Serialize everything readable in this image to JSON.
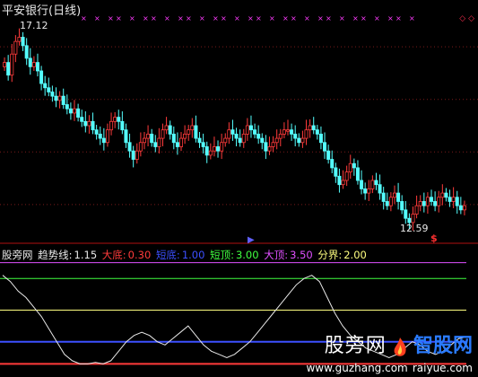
{
  "chart": {
    "title": "平安银行(日线)",
    "high_label": "17.12",
    "low_label": "12.59",
    "colors": {
      "up": "#ff3b3b",
      "down": "#54ffff",
      "bg": "#000000"
    }
  },
  "indicator": {
    "name": "股旁网",
    "trend": {
      "label": "趋势线:",
      "value": "1.15",
      "color": "#e8e8e8"
    },
    "bottom": {
      "label": "大底:",
      "value": "0.30",
      "color": "#ff3b3b"
    },
    "short_bottom": {
      "label": "短底:",
      "value": "1.00",
      "color": "#3c50ff"
    },
    "short_top": {
      "label": "短顶:",
      "value": "3.00",
      "color": "#40ff40"
    },
    "top": {
      "label": "大顶:",
      "value": "3.50",
      "color": "#e050ff"
    },
    "divider": {
      "label": "分界:",
      "value": "2.00",
      "color": "#ffff80"
    }
  },
  "watermark": {
    "cn": "股旁网",
    "brand": "智股网",
    "url": "www.guzhang.com",
    "url2": "raiyue.com"
  },
  "chart_data": [
    {
      "type": "candlestick",
      "title": "平安银行(日线)",
      "annotations": [
        "17.12",
        "12.59"
      ],
      "ylim": [
        12.3,
        17.5
      ],
      "close": [
        16.4,
        16.1,
        16.6,
        16.9,
        17.0,
        16.8,
        16.5,
        16.3,
        16.4,
        16.2,
        15.9,
        15.8,
        15.7,
        15.6,
        15.5,
        15.6,
        15.4,
        15.3,
        15.2,
        15.3,
        15.1,
        15.0,
        14.9,
        15.0,
        14.8,
        14.7,
        14.6,
        14.5,
        14.8,
        15.0,
        15.1,
        15.0,
        14.8,
        14.5,
        14.3,
        14.1,
        14.3,
        14.5,
        14.6,
        14.7,
        14.5,
        14.4,
        14.6,
        14.8,
        14.9,
        14.7,
        14.5,
        14.4,
        14.6,
        14.7,
        14.8,
        14.9,
        14.6,
        14.5,
        14.4,
        14.2,
        14.3,
        14.4,
        14.3,
        14.5,
        14.6,
        14.8,
        14.7,
        14.6,
        14.5,
        14.7,
        14.9,
        14.8,
        14.7,
        14.6,
        14.5,
        14.3,
        14.4,
        14.5,
        14.6,
        14.7,
        14.8,
        14.8,
        14.7,
        14.6,
        14.5,
        14.6,
        14.8,
        14.9,
        14.8,
        14.7,
        14.5,
        14.3,
        14.1,
        13.9,
        13.7,
        13.5,
        13.6,
        13.8,
        14.0,
        13.9,
        13.6,
        13.4,
        13.3,
        13.4,
        13.6,
        13.5,
        13.3,
        13.1,
        13.0,
        13.2,
        13.3,
        13.1,
        12.9,
        12.7,
        12.6,
        12.8,
        13.0,
        13.1,
        13.0,
        13.2,
        13.1,
        13.0,
        13.2,
        13.3,
        13.2,
        13.1,
        13.2,
        13.0,
        12.9,
        13.0
      ]
    },
    {
      "type": "line",
      "series": [
        {
          "name": "趋势线",
          "values": [
            3.1,
            2.9,
            2.6,
            2.4,
            2.1,
            1.8,
            1.4,
            1.0,
            0.6,
            0.4,
            0.3,
            0.3,
            0.35,
            0.3,
            0.4,
            0.7,
            1.0,
            1.2,
            1.3,
            1.2,
            1.0,
            0.9,
            1.1,
            1.3,
            1.5,
            1.2,
            0.9,
            0.7,
            0.6,
            0.5,
            0.6,
            0.8,
            1.0,
            1.3,
            1.6,
            1.9,
            2.2,
            2.5,
            2.8,
            3.0,
            3.1,
            2.9,
            2.4,
            1.9,
            1.5,
            1.2,
            1.0,
            0.8,
            0.7,
            0.6,
            0.5,
            0.6,
            0.8,
            1.0,
            0.9,
            0.7,
            0.6,
            0.7,
            0.9,
            1.1,
            1.15
          ]
        }
      ],
      "reference_lines": [
        0.3,
        1.0,
        2.0,
        3.0,
        3.5
      ]
    }
  ]
}
